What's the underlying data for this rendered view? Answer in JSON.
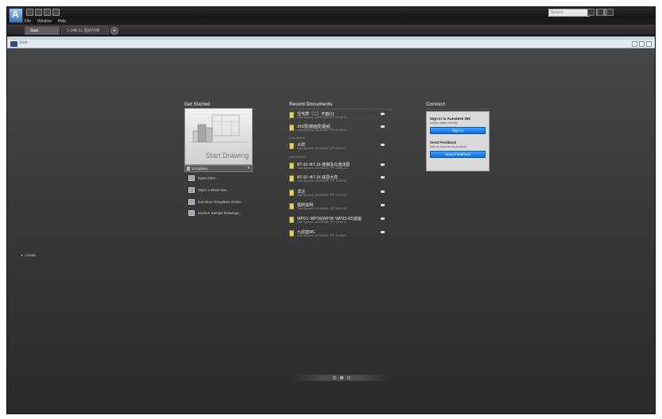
{
  "window": {
    "search_placeholder": "Search"
  },
  "menu": [
    "File",
    "Window",
    "Help"
  ],
  "tabs": {
    "start": "Start",
    "drawing": "1-04B 01 图纸列表",
    "new_tab": "+"
  },
  "nav": {
    "label": "Start"
  },
  "get_started": {
    "heading": "Get Started",
    "start_drawing": "Start Drawing",
    "templates": "Templates",
    "links": [
      {
        "label": "Open Files...",
        "icon": "folder-icon"
      },
      {
        "label": "Open a Sheet Set...",
        "icon": "sheet-set-icon"
      },
      {
        "label": "Get More Templates Online",
        "icon": "templates-online-icon"
      },
      {
        "label": "Explore Sample Drawings...",
        "icon": "sample-drawings-icon"
      }
    ]
  },
  "recent_documents": {
    "heading": "Recent Documents",
    "groups": [
      {
        "label": "",
        "docs": [
          {
            "name": "住宅楼（二）平面(1)",
            "time": "Last Opened: 2019/10/28 下午 02:38:15"
          },
          {
            "name": "1#3层(楼面层)图纸",
            "time": "Last Opened: 2019/10/28 下午 02:35:41"
          }
        ]
      },
      {
        "label": "Last Month",
        "docs": [
          {
            "name": "大样",
            "time": "Last Opened: 2019/09/30 上午 09:09:17"
          }
        ]
      },
      {
        "label": "Last Month",
        "docs": [
          {
            "name": "BT-01~BT-16 楼梯及北墙详图",
            "time": "Last Opened: 2019/09/26 下午 02:58:21"
          },
          {
            "name": "BT-01~BT-16 底层大样",
            "time": "Last Opened: 2019/09/26 下午 02:54:33"
          },
          {
            "name": "发达",
            "time": "Last Opened: 2019/09/26 下午 02:53:02"
          },
          {
            "name": "图例说明",
            "time": "Last Opened: 2019/09/26 下午 02:51:45"
          },
          {
            "name": "WP01~WP16(WP18~WP23-02)屋面",
            "time": "Last Opened: 2019/09/26 下午 02:51:12"
          },
          {
            "name": "九鼎室MC",
            "time": "Last Opened: 2019/09/26 下午 02:50:57"
          }
        ]
      }
    ]
  },
  "connect": {
    "heading": "Connect",
    "sign_in_title": "Sign In to Autodesk 360",
    "sign_in_desc": "access online services",
    "sign_in_button": "Sign In",
    "feedback_title": "Send Feedback",
    "feedback_desc": "Help us improve our products",
    "feedback_button": "Send Feedback"
  },
  "create": {
    "arrow": "◂",
    "label": "Create"
  },
  "colors": {
    "accent_blue": "#1a80f0",
    "canvas_top": "#474747",
    "canvas_bottom": "#2a2a2a"
  }
}
